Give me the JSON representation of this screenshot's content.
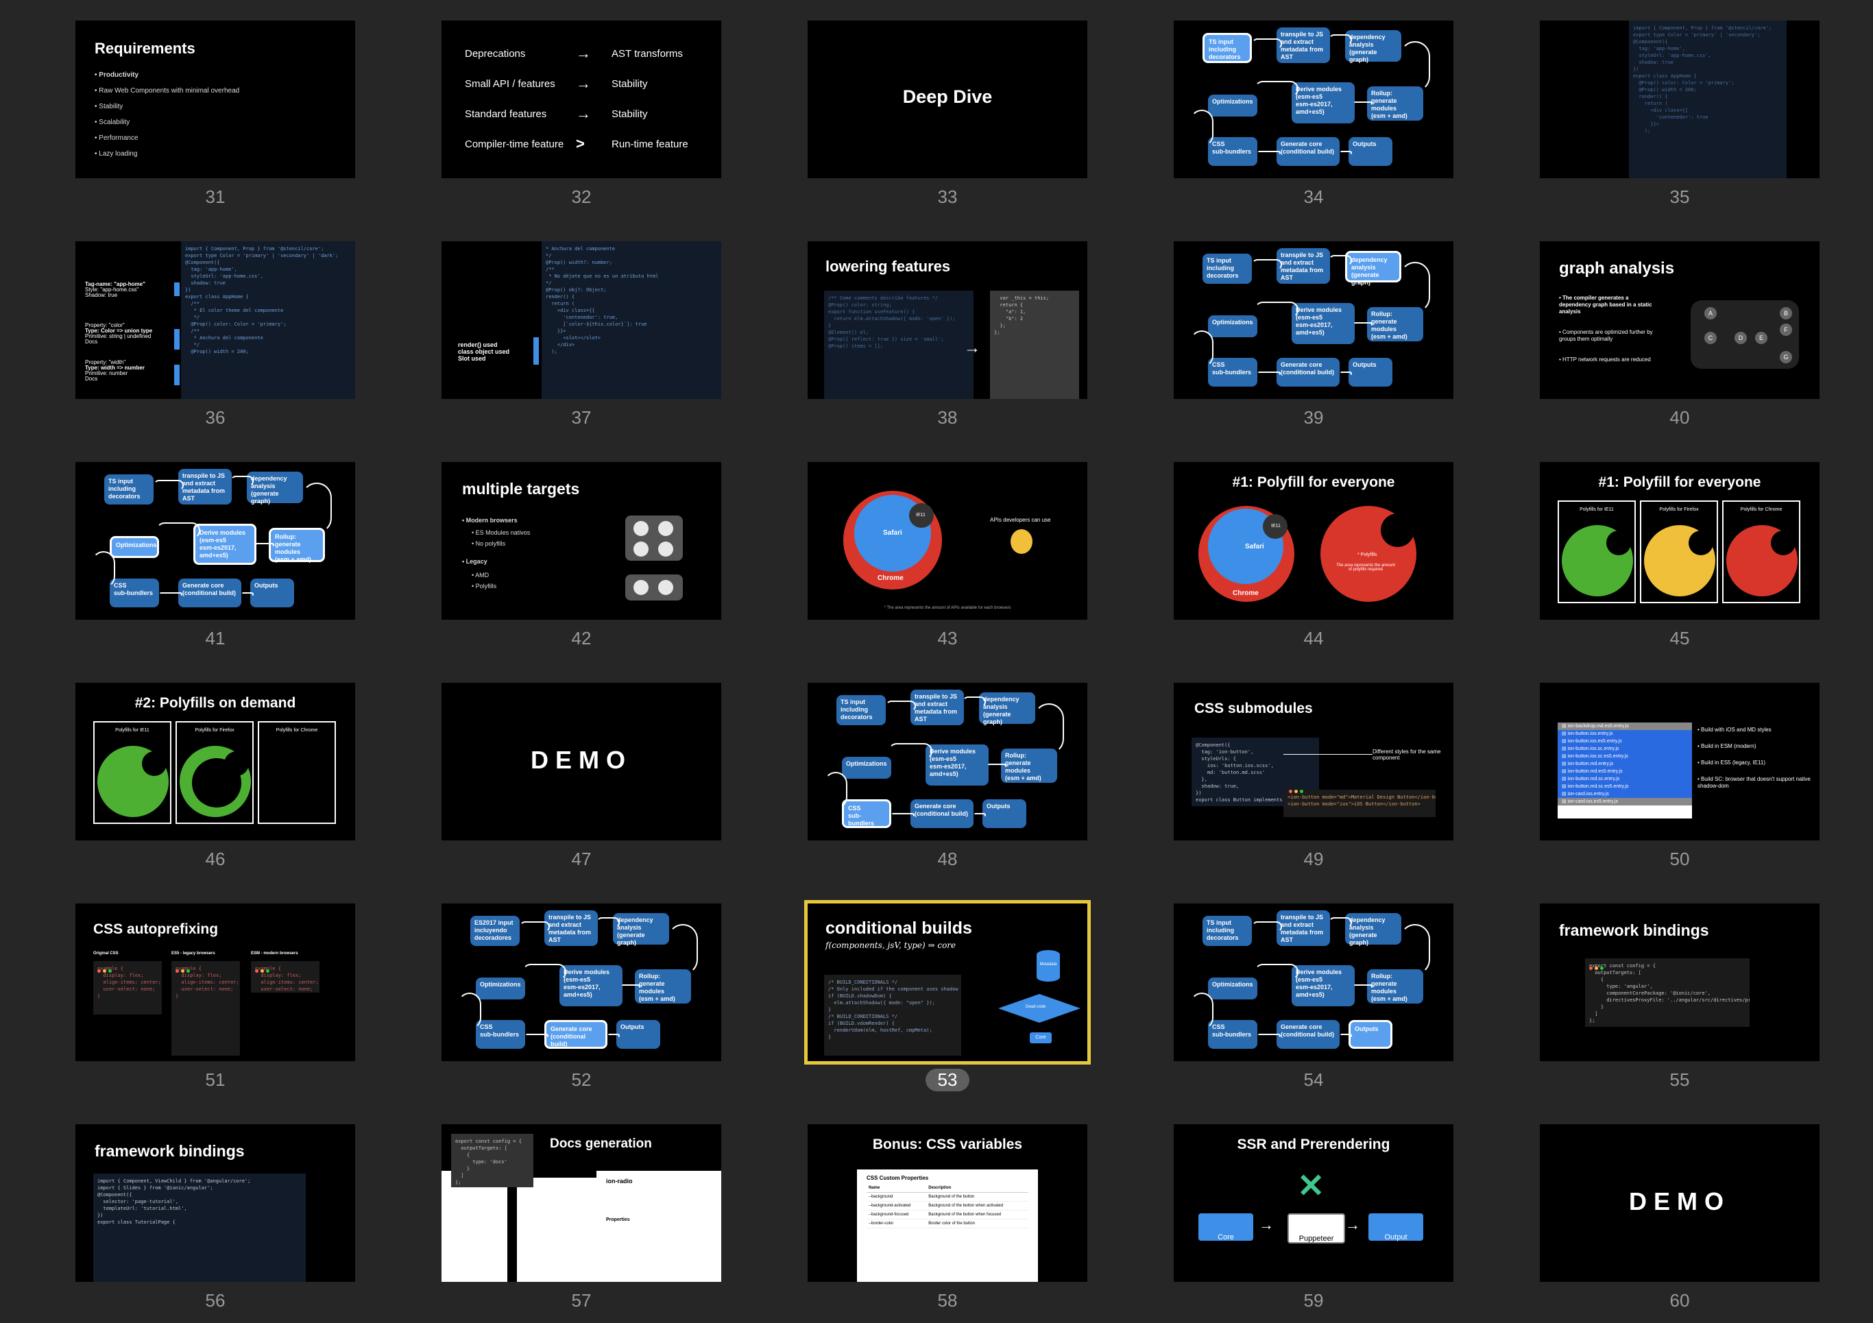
{
  "slides": [
    {
      "number": "31",
      "title": "Requirements",
      "bullets": [
        "Productivity",
        "Raw Web Components with minimal overhead",
        "Stability",
        "Scalability",
        "Performance",
        "Lazy loading"
      ]
    },
    {
      "number": "32",
      "rows": [
        [
          "Deprecations",
          "→",
          "AST transforms"
        ],
        [
          "Small API / features",
          "→",
          "Stability"
        ],
        [
          "Standard features",
          "→",
          "Stability"
        ],
        [
          "Compiler-time feature",
          ">",
          "Run-time feature"
        ]
      ]
    },
    {
      "number": "33",
      "title": "Deep Dive"
    },
    {
      "number": "34"
    },
    {
      "number": "35"
    },
    {
      "number": "36",
      "labels": [
        "Tag-name: \"app-home\"",
        "Style: \"app-home.css\"",
        "Shadow: true",
        "Property: \"color\"",
        "Type: Color => union type",
        "Primitive: string | undefined",
        "Docs",
        "Property: \"width\"",
        "Type: width => number",
        "Primitive: number",
        "Docs"
      ],
      "code": [
        "import { Component, Prop } from '@stencil/core';",
        "export type Color = 'primary' | 'secondary' | 'dark';",
        "@Component({",
        "  tag: 'app-home',",
        "  styleUrl: 'app-home.css',",
        "  shadow: true",
        "})",
        "export class AppHome {",
        "  /**",
        "   * El color theme del componente",
        "   */",
        "  @Prop() color: Color = 'primary';",
        "  /**",
        "   * Anchura del componente",
        "   */",
        "  @Prop() width = 200;"
      ]
    },
    {
      "number": "37",
      "labels": [
        "render() used",
        "class object used",
        "Slot used"
      ],
      "code": [
        "* Anchura del componente",
        "*/",
        "@Prop() width?: number;",
        "/**",
        " * No déjate que no es un atributo html",
        "*/",
        "@Prop() obj?: Object;",
        "render() {",
        "  return (",
        "    <div class={{",
        "      'contenedor': true,",
        "      [`color-${this.color}`]: true",
        "    }}>",
        "      <slot></slot>",
        "    </div>",
        "  );"
      ]
    },
    {
      "number": "38",
      "title": "lowering features"
    },
    {
      "number": "39"
    },
    {
      "number": "40",
      "title": "graph analysis",
      "bullets": [
        "The compiler generates a dependency graph based in a static analysis",
        "Components are optimized further by groups them optimally",
        "HTTP network requests are reduced"
      ],
      "nodes": [
        "A",
        "B",
        "C",
        "D",
        "E",
        "F",
        "G"
      ]
    },
    {
      "number": "41"
    },
    {
      "number": "42",
      "title": "multiple targets",
      "bullets": [
        "Modern browsers",
        "ES Modules nativos",
        "No polyfills",
        "Legacy",
        "AMD",
        "Polyfills"
      ]
    },
    {
      "number": "43",
      "labels": [
        "IE11",
        "Safari",
        "Chrome",
        "APIs developers can use"
      ],
      "footnote": "* The area represents the amount of APIs available for each browsers"
    },
    {
      "number": "44",
      "title": "#1: Polyfill for everyone",
      "labels": [
        "IE11",
        "Safari",
        "Chrome",
        "* Polyfills",
        "The area represents the amount of polyfills required"
      ]
    },
    {
      "number": "45",
      "title": "#1: Polyfill for everyone",
      "panels": [
        "Polyfills for IE11",
        "Polyfills for Firefox",
        "Polyfills for Chrome"
      ]
    },
    {
      "number": "46",
      "title": "#2: Polyfills on demand",
      "panels": [
        "Polyfills for IE11",
        "Polyfills for Firefox",
        "Polyfills for Chrome"
      ]
    },
    {
      "number": "47",
      "title": "DEMO"
    },
    {
      "number": "48"
    },
    {
      "number": "49",
      "title": "CSS submodules",
      "annotation": "Different styles for the same component",
      "code": [
        "@Component({",
        "  tag: 'ion-button',",
        "  styleUrls: {",
        "    ios: 'button.ios.scss',",
        "    md: 'button.md.scss'",
        "  },",
        "  shadow: true,",
        "})",
        "export class Button implements"
      ],
      "code2": [
        "<ion-button mode=\"md\">Material Design Button</ion-button>",
        "<ion-button mode=\"ios\">iOS Button</ion-button>"
      ]
    },
    {
      "number": "50",
      "bullets": [
        "Build with iOS and MD styles",
        "Build in ESM (modern)",
        "Build in ES5 (legacy, IE11)",
        "Build SC: browser that doesn't support native shadow-dom"
      ],
      "files": [
        "ion-backdrop.md.es5.entry.js",
        "ion-button.ios.entry.js",
        "ion-button.ios.es5.entry.js",
        "ion-button.ios.sc.entry.js",
        "ion-button.ios.sc.es5.entry.js",
        "ion-button.md.entry.js",
        "ion-button.md.es5.entry.js",
        "ion-button.md.sc.entry.js",
        "ion-button.md.sc.es5.entry.js",
        "ion-card.ios.entry.js",
        "ion-card.ios.es5.entry.js"
      ]
    },
    {
      "number": "51",
      "title": "CSS autoprefixing",
      "panels": [
        "Original CSS",
        "ES5 - legacy browsers",
        "ESM - modern browsers"
      ]
    },
    {
      "number": "52"
    },
    {
      "number": "53",
      "title": "conditional builds",
      "subtitle": "f(components, jsV, type) ⇒ core",
      "labels": [
        "Metadata",
        "Dead-code",
        "Core"
      ]
    },
    {
      "number": "54"
    },
    {
      "number": "55",
      "title": "framework bindings",
      "code": [
        "export const config = {",
        "  outputTargets: [",
        "    {",
        "      type: 'angular',",
        "      componentCorePackage: '@ionic/core',",
        "      directivesProxyFile: '../angular/src/directives/proxies.ts',",
        "    }",
        "  ]",
        "};"
      ]
    },
    {
      "number": "56",
      "title": "framework bindings",
      "code": [
        "import { Component, ViewChild } from '@angular/core';",
        "import { Slides } from '@ionic/angular';",
        "@Component({",
        "  selector: 'page-tutorial',",
        "  templateUrl: 'tutorial.html',",
        "})",
        "export class TutorialPage {"
      ]
    },
    {
      "number": "57",
      "title": "Docs generation",
      "labels": [
        "ion-radio",
        "Properties"
      ]
    },
    {
      "number": "58",
      "title": "Bonus: CSS variables",
      "table_title": "CSS Custom Properties",
      "headers": [
        "Name",
        "Description"
      ],
      "rows": [
        [
          "--background",
          "Background of the button"
        ],
        [
          "--background-activated",
          "Background of the button when activated"
        ],
        [
          "--background-focused",
          "Background of the button when focused"
        ],
        [
          "--border-color",
          "Border color of the button"
        ]
      ]
    },
    {
      "number": "59",
      "title": "SSR and Prerendering",
      "labels": [
        "Core",
        "Puppeteer",
        "Output"
      ]
    },
    {
      "number": "60",
      "title": "DEMO"
    }
  ],
  "diagram": {
    "ts_input": "TS input\nincluding\ndecorators",
    "es2017_input": "ES2017 input\nincluyendo\ndecoradores",
    "transpile": "transpile to JS\nand extract\nmetadata from\nAST",
    "dependency": "dependency\nanalysis\n(generate graph)",
    "optimizations": "Optimizations",
    "derive": "Derive modules\n(esm-es5\nesm-es2017,\namd+es5)",
    "rollup": "Rollup: generate\nmodules\n(esm + amd)",
    "css": "CSS\nsub-bundlers",
    "generate_core": "Generate core\n(conditional build)",
    "outputs": "Outputs"
  },
  "selected_slide": "53",
  "colors": {
    "background": "#262626",
    "selection": "#e6c83c",
    "box": "#2a6aae",
    "box_highlight": "#5aa0ee",
    "chrome_red": "#d9362b",
    "safari_blue": "#3d8fe8",
    "green": "#4db033",
    "yellow": "#f0c03a"
  }
}
